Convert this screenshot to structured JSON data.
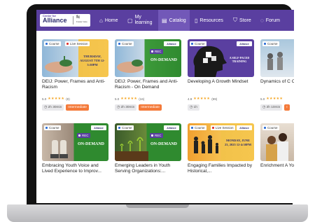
{
  "nav": {
    "logo_top": "Center for",
    "logo_main": "Alliance",
    "logo_fc": "fc",
    "logo_sub": "Foster Care",
    "items": [
      {
        "label": "Home",
        "icon": "home-icon"
      },
      {
        "label": "My",
        "label2": "learning",
        "icon": "book-icon"
      },
      {
        "label": "Catalog",
        "icon": "catalog-icon",
        "active": true
      },
      {
        "label": "Resources",
        "icon": "document-icon"
      },
      {
        "label": "Store",
        "icon": "cart-icon"
      },
      {
        "label": "Forum",
        "icon": "chat-icon"
      }
    ]
  },
  "cards": [
    {
      "badges": [
        "Course",
        "Live Session"
      ],
      "thumb_text": "THURSDAY, AUGUST 7TH 12-3:30PM",
      "title": "DEIJ: Power, Frames and Anti-Racism",
      "rating": "5.0",
      "reviews": "(8)",
      "duration": "2h 30min",
      "level": "Intermediate"
    },
    {
      "badges": [
        "Course"
      ],
      "brand": "Alliance",
      "rec": "REC",
      "thumb_text": "ON-DEMAND",
      "title": "DEIJ: Power, Frames and Anti-Racism - On Demand",
      "rating": "5.0",
      "reviews": "(16)",
      "duration": "2h 30min",
      "level": "Intermediate"
    },
    {
      "badges": [
        "Course"
      ],
      "brand": "Alliance",
      "thumb_text": "A SELF-PACED TRAINING",
      "title": "Developing A Growth Mindset",
      "rating": "4.9",
      "reviews": "(99)",
      "duration": "1h",
      "level": ""
    },
    {
      "badges": [
        "Course"
      ],
      "thumb_text": "",
      "title": "Dynamics of C Culture - On D",
      "rating": "5.0",
      "reviews": "",
      "duration": "3h 10min",
      "level": "I"
    },
    {
      "badges": [
        "Course"
      ],
      "brand": "Alliance",
      "rec": "REC",
      "thumb_text": "ON-DEMAND",
      "title": "Embracing Youth Voice and Lived Experience to Improv...",
      "rating": "",
      "reviews": "",
      "duration": "",
      "level": ""
    },
    {
      "badges": [
        "Course"
      ],
      "brand": "Alliance",
      "rec": "REC",
      "thumb_text": "ON-DEMAND",
      "title": "Emerging Leaders in Youth Serving Organizations:...",
      "rating": "",
      "reviews": "",
      "duration": "",
      "level": ""
    },
    {
      "badges": [
        "Course",
        "Live Session"
      ],
      "brand": "Alliance",
      "thumb_text": "MONDAY, JUNE 23, 2025 12-4:30PM",
      "title": "Engaging Families Impacted by Historical,...",
      "rating": "",
      "reviews": "",
      "duration": "",
      "level": ""
    },
    {
      "badges": [
        "Course"
      ],
      "thumb_text": "",
      "title": "Enrichment A Youth in Foste",
      "rating": "",
      "reviews": "",
      "duration": "",
      "level": ""
    }
  ],
  "colors": {
    "nav_bg": "#5a3fa0",
    "nav_active": "#7258b8",
    "accent_orange": "#f47a3a",
    "star": "#f5a623",
    "course_dot": "#2f6fd6",
    "live_dot": "#e0332e",
    "rec_bg": "#5a3fa0"
  }
}
